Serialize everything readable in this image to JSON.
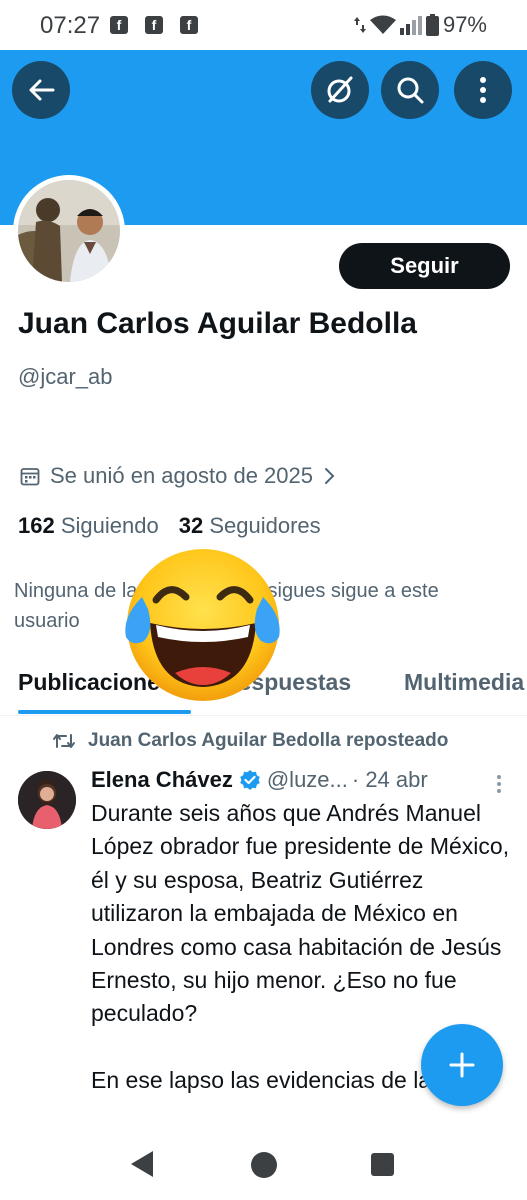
{
  "status_bar": {
    "time": "07:27",
    "notification_icons": [
      "facebook-icon",
      "facebook-icon",
      "facebook-icon"
    ],
    "battery": "97%"
  },
  "header": {
    "back_icon": "arrow-left-icon",
    "action_icons": [
      "grok-icon",
      "search-icon",
      "more-vertical-icon"
    ],
    "banner_color": "#1d9bf0"
  },
  "profile": {
    "follow_label": "Seguir",
    "display_name": "Juan Carlos Aguilar Bedolla",
    "handle": "@jcar_ab",
    "joined": "Se unió en agosto de 2025",
    "following_count": "162",
    "following_label": "Siguiendo",
    "followers_count": "32",
    "followers_label": "Seguidores",
    "mutuals_text": "Ninguna de las cuentas que sigues sigue a este usuario"
  },
  "tabs": [
    {
      "label": "Publicaciones",
      "active": true
    },
    {
      "label": "Respuestas",
      "active": false
    },
    {
      "label": "Multimedia",
      "active": false
    }
  ],
  "overlay_emoji": "face-with-tears-of-joy",
  "post": {
    "repost_label": "Juan Carlos Aguilar Bedolla reposteado",
    "author_name": "Elena Chávez",
    "author_handle": "@luze...",
    "date": "· 24 abr",
    "text": "Durante seis años que Andrés Manuel López obrador fue presidente de México, él y su esposa, Beatriz Gutiérrez utilizaron la embajada de México en Londres como casa habitación de Jesús Ernesto, su hijo menor. ¿Eso no fue peculado?\n\nEn ese lapso las evidencias de la"
  },
  "colors": {
    "accent": "#1d9bf0",
    "header_button": "#184968",
    "text_primary": "#0f1419",
    "text_secondary": "#536471"
  }
}
